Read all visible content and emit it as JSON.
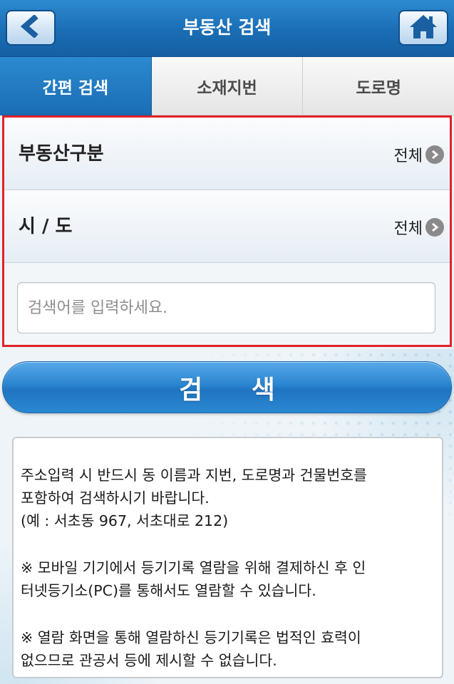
{
  "header": {
    "title": "부동산 검색",
    "back_icon": "chevron-left-icon",
    "home_icon": "home-icon"
  },
  "tabs": [
    {
      "label": "간편 검색",
      "active": true
    },
    {
      "label": "소재지번",
      "active": false
    },
    {
      "label": "도로명",
      "active": false
    }
  ],
  "form": {
    "property_type": {
      "label": "부동산구분",
      "value": "전체"
    },
    "region": {
      "label": "시 / 도",
      "value": "전체"
    },
    "search": {
      "placeholder": "검색어를 입력하세요.",
      "value": ""
    }
  },
  "search_button": {
    "label": "검 색"
  },
  "notice": {
    "lines_1": [
      "주소입력 시 반드시 동 이름과 지번, 도로명과 건물번호를",
      "포함하여 검색하시기 바랍니다.",
      "(예 : 서초동 967, 서초대로 212)"
    ],
    "lines_2": [
      "※ 모바일 기기에서 등기기록 열람을 위해 결제하신 후 인",
      "터넷등기소(PC)를 통해서도 열람할 수 있습니다."
    ],
    "lines_3": [
      "※ 열람 화면을 통해 열람하신 등기기록은 법적인 효력이",
      "없으므로 관공서 등에 제시할 수 없습니다."
    ]
  },
  "colors": {
    "header_blue": "#1a6db4",
    "highlight_border": "#e0222a",
    "button_blue": "#2a85d0"
  }
}
